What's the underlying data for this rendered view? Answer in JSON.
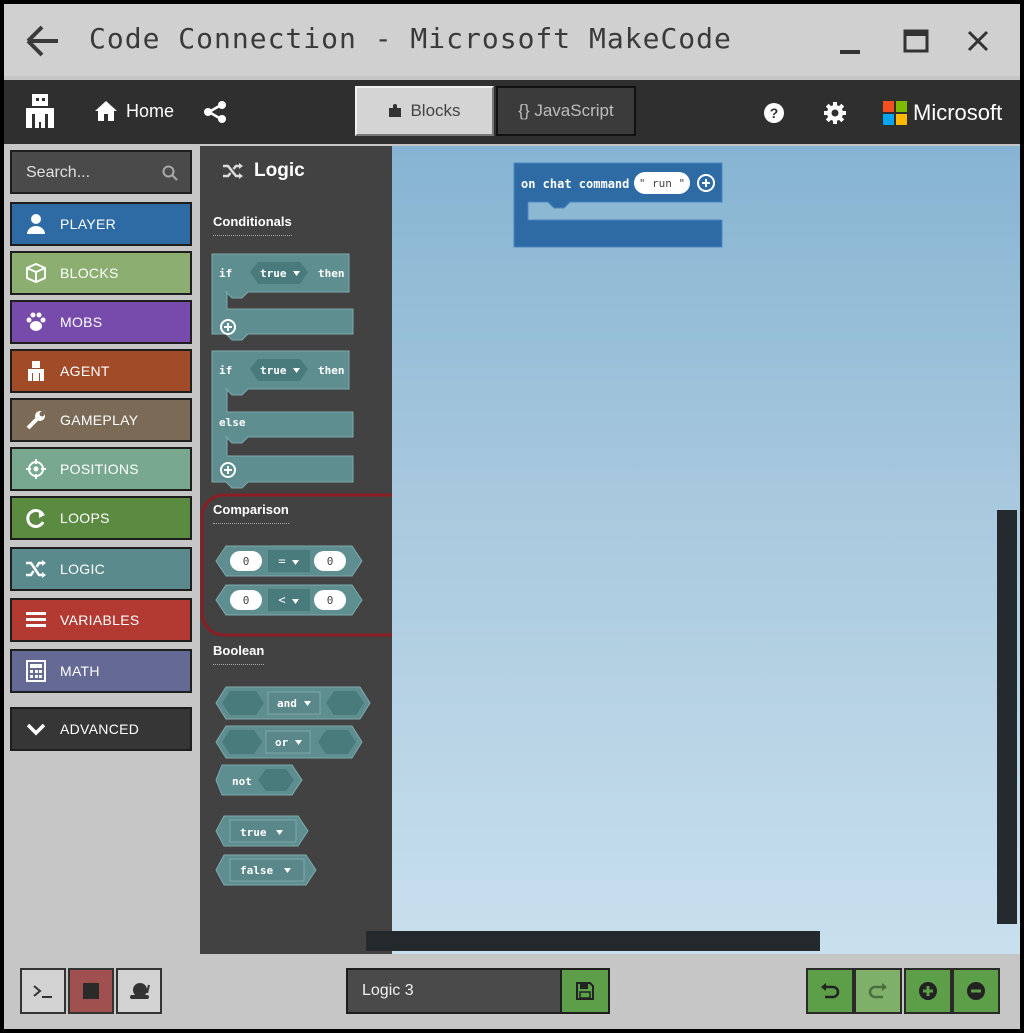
{
  "window": {
    "title": "Code Connection - Microsoft MakeCode"
  },
  "toolbar": {
    "home_label": "Home",
    "blocks_tab": "Blocks",
    "javascript_tab": "{} JavaScript",
    "brand": "Microsoft"
  },
  "search": {
    "placeholder": "Search..."
  },
  "categories": [
    {
      "label": "PLAYER",
      "color": "#2e6aa3",
      "icon": "person-icon"
    },
    {
      "label": "BLOCKS",
      "color": "#8cae70",
      "icon": "cube-icon"
    },
    {
      "label": "MOBS",
      "color": "#764bac",
      "icon": "paw-icon"
    },
    {
      "label": "AGENT",
      "color": "#a24b28",
      "icon": "agent-icon"
    },
    {
      "label": "GAMEPLAY",
      "color": "#7b6a55",
      "icon": "wrench-icon"
    },
    {
      "label": "POSITIONS",
      "color": "#78a890",
      "icon": "crosshair-icon"
    },
    {
      "label": "LOOPS",
      "color": "#5b8a41",
      "icon": "loop-icon"
    },
    {
      "label": "LOGIC",
      "color": "#5a8a8c",
      "icon": "shuffle-icon"
    },
    {
      "label": "VARIABLES",
      "color": "#b23a33",
      "icon": "lines-icon"
    },
    {
      "label": "MATH",
      "color": "#656a94",
      "icon": "calculator-icon"
    },
    {
      "label": "ADVANCED",
      "color": "#363636",
      "icon": "chevron-down-icon"
    }
  ],
  "flyout": {
    "title": "Logic",
    "section_conditionals": "Conditionals",
    "section_comparison": "Comparison",
    "section_boolean": "Boolean",
    "kw_if": "if",
    "kw_then": "then",
    "kw_else": "else",
    "kw_true": "true",
    "kw_false": "false",
    "kw_and": "and",
    "kw_or": "or",
    "kw_not": "not",
    "op_eq": "=",
    "op_lt": "<",
    "num_zero": "0",
    "block_color": "#5f8e91",
    "highlight_color": "#8b1d24"
  },
  "workspace": {
    "event_label": "on chat command",
    "event_arg": "\" run \"",
    "event_color": "#2e6aa3"
  },
  "project": {
    "name": "Logic 3"
  }
}
